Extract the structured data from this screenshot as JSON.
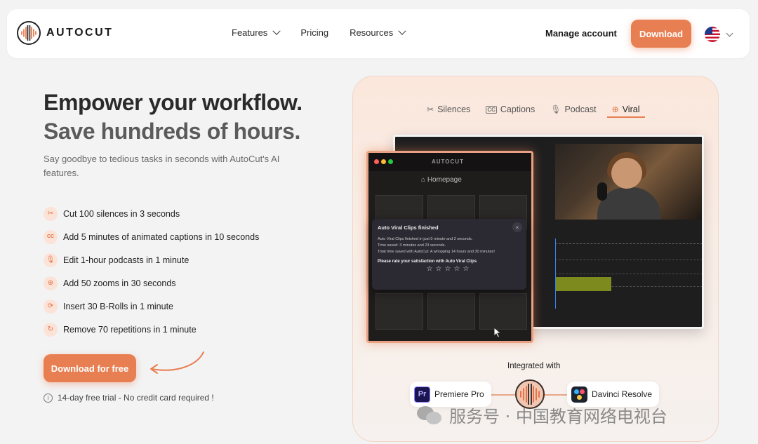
{
  "nav": {
    "logo_text": "AUTOCUT",
    "menu": [
      {
        "label": "Features",
        "has_dropdown": true
      },
      {
        "label": "Pricing",
        "has_dropdown": false
      },
      {
        "label": "Resources",
        "has_dropdown": true
      }
    ],
    "manage_account": "Manage account",
    "download": "Download",
    "language_flag": "us-flag-icon"
  },
  "hero": {
    "title_line1": "Empower your workflow.",
    "title_line2": "Save hundreds of hours.",
    "subtitle": "Say goodbye to tedious tasks in seconds with AutoCut's AI features.",
    "features": [
      {
        "icon": "scissors-icon",
        "glyph": "✂",
        "text": "Cut 100 silences in 3 seconds"
      },
      {
        "icon": "captions-icon",
        "glyph": "CC",
        "text": "Add 5 minutes of animated captions in 10 seconds"
      },
      {
        "icon": "microphone-icon",
        "glyph": "🎙",
        "text": "Edit 1-hour podcasts in 1 minute"
      },
      {
        "icon": "zoom-icon",
        "glyph": "⊕",
        "text": "Add 50 zooms in 30 seconds"
      },
      {
        "icon": "broll-icon",
        "glyph": "⟳",
        "text": "Insert 30 B-Rolls in 1 minute"
      },
      {
        "icon": "repeat-icon",
        "glyph": "↻",
        "text": "Remove 70 repetitions in 1 minute"
      }
    ],
    "cta": "Download for free",
    "trial": "14-day free trial - No credit card required !"
  },
  "demo": {
    "tabs": [
      {
        "icon": "scissors-icon",
        "glyph": "✂",
        "label": "Silences",
        "active": false
      },
      {
        "icon": "captions-icon",
        "glyph": "CC",
        "label": "Captions",
        "active": false
      },
      {
        "icon": "microphone-icon",
        "glyph": "🎙",
        "label": "Podcast",
        "active": false
      },
      {
        "icon": "zoom-icon",
        "glyph": "⊕",
        "label": "Viral",
        "active": true
      }
    ],
    "plugin_logo": "AUTOCUT",
    "plugin_home": "Homepage",
    "dialog": {
      "title": "Auto Viral Clips finished",
      "line1": "Auto Viral Clips finished in just 0 minute and 2 seconds.",
      "line2": "Time saved: 3 minutes and 23 seconds.",
      "line3": "Total time saved with AutoCut: A whopping 14 hours and 30 minutes!",
      "rate": "Please rate your satisfaction with Auto Viral Clips",
      "stars": "☆☆☆☆☆"
    }
  },
  "integrations": {
    "label": "Integrated with",
    "premiere": "Premiere Pro",
    "premiere_abbr": "Pr",
    "davinci": "Davinci Resolve"
  },
  "watermark": "服务号 · 中国教育网络电视台",
  "colors": {
    "accent": "#e87f52",
    "background": "#f3f3f4"
  }
}
